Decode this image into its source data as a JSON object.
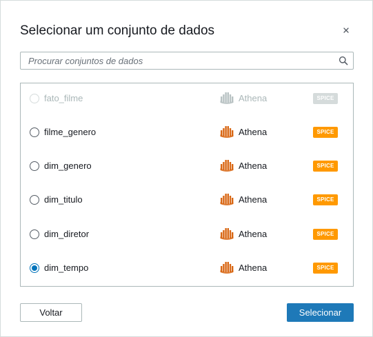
{
  "dialog": {
    "title": "Selecionar um conjunto de dados",
    "close_icon": "close-icon"
  },
  "search": {
    "placeholder": "Procurar conjuntos de dados",
    "value": "",
    "icon": "search-icon"
  },
  "colors": {
    "accent": "#0073bb",
    "primary_button": "#1e79b8",
    "spice_badge": "#ff9900",
    "athena_icon": "#d86613",
    "disabled": "#aab7b8"
  },
  "datasets": [
    {
      "name": "fato_filme",
      "source": "Athena",
      "badge": "SPICE",
      "disabled": true,
      "selected": false,
      "source_icon": "athena-icon"
    },
    {
      "name": "filme_genero",
      "source": "Athena",
      "badge": "SPICE",
      "disabled": false,
      "selected": false,
      "source_icon": "athena-icon"
    },
    {
      "name": "dim_genero",
      "source": "Athena",
      "badge": "SPICE",
      "disabled": false,
      "selected": false,
      "source_icon": "athena-icon"
    },
    {
      "name": "dim_titulo",
      "source": "Athena",
      "badge": "SPICE",
      "disabled": false,
      "selected": false,
      "source_icon": "athena-icon"
    },
    {
      "name": "dim_diretor",
      "source": "Athena",
      "badge": "SPICE",
      "disabled": false,
      "selected": false,
      "source_icon": "athena-icon"
    },
    {
      "name": "dim_tempo",
      "source": "Athena",
      "badge": "SPICE",
      "disabled": false,
      "selected": true,
      "source_icon": "athena-icon"
    }
  ],
  "footer": {
    "back_label": "Voltar",
    "select_label": "Selecionar"
  }
}
